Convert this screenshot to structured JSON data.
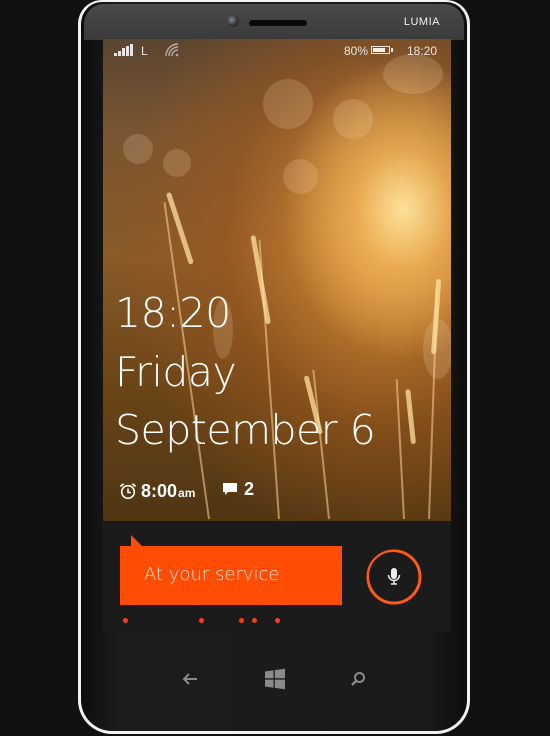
{
  "device": {
    "brand": "LUMIA"
  },
  "status_bar": {
    "signal_icon": "signal-bars-icon",
    "network_type": "L",
    "wifi_icon": "wifi-icon",
    "battery_percent_label": "80%",
    "battery_level": 0.8,
    "battery_icon": "battery-icon",
    "time": "18:20"
  },
  "lock_screen": {
    "time": "18:20",
    "day": "Friday",
    "date": "September 6",
    "alarm": {
      "icon": "alarm-clock-icon",
      "time": "8:00",
      "period": "am"
    },
    "messages": {
      "icon": "message-icon",
      "count": "2"
    }
  },
  "cortana": {
    "greeting": "At your service",
    "mic_icon": "microphone-icon",
    "accent_color": "#ff4d06"
  },
  "nav_bar": {
    "back_icon": "back-arrow-icon",
    "start_icon": "windows-logo-icon",
    "search_icon": "search-icon"
  }
}
